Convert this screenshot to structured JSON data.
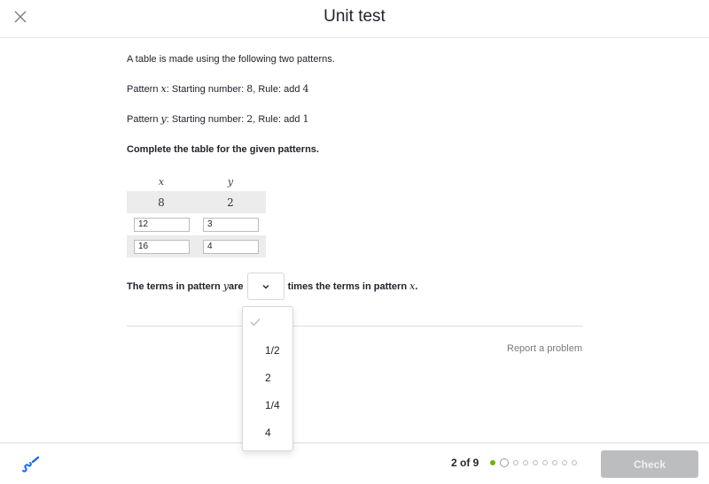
{
  "header": {
    "title": "Unit test",
    "close_icon": "close-icon"
  },
  "question": {
    "intro": "A table is made using the following two patterns.",
    "pattern_x": {
      "label": "Pattern ",
      "var": "x",
      "mid": ": Starting number: ",
      "start": "8",
      "rule_text": ", Rule: add ",
      "rule": "4"
    },
    "pattern_y": {
      "label": "Pattern ",
      "var": "y",
      "mid": ": Starting number: ",
      "start": "2",
      "rule_text": ", Rule: add ",
      "rule": "1"
    },
    "instruction": "Complete the table for the given patterns."
  },
  "table": {
    "headers": [
      "x",
      "y"
    ],
    "first_row": [
      "8",
      "2"
    ],
    "input_rows": [
      {
        "x": "12",
        "y": "3"
      },
      {
        "x": "16",
        "y": "4"
      }
    ]
  },
  "sentence": {
    "before": "The terms in pattern ",
    "var_y": "y",
    "are": " are",
    "after": "times the terms in pattern ",
    "var_x": "x",
    "end": ".",
    "selected": ""
  },
  "dropdown_menu": {
    "options": [
      "1/2",
      "2",
      "1/4",
      "4"
    ]
  },
  "report_link": "Report a problem",
  "footer": {
    "counter": "2 of 9",
    "total": 9,
    "completed": 1,
    "current": 2,
    "check_label": "Check",
    "accent_color": "#71b307"
  }
}
